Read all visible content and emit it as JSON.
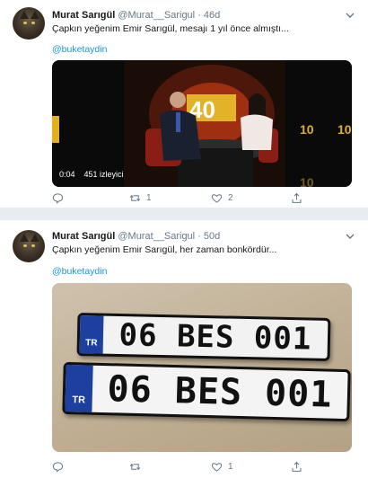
{
  "tweets": [
    {
      "name": "Murat Sarıgül",
      "handle": "@Murat__Sarigul",
      "sep": "·",
      "age": "46d",
      "text": "Çapkın yeğenim Emir Sarıgül, mesajı 1 yıl önce almıştı...",
      "mention": "@buketaydin",
      "video": {
        "time": "0:04",
        "views": "451 izleyici",
        "set_text": "40"
      },
      "actions": {
        "reply": "",
        "retweet": "1",
        "like": "2",
        "share": ""
      }
    },
    {
      "name": "Murat Sarıgül",
      "handle": "@Murat__Sarigul",
      "sep": "·",
      "age": "50d",
      "text": "Çapkın yeğenim Emir Sarıgül, her zaman bonkördür...",
      "mention": "@buketaydin",
      "plates": [
        {
          "country": "TR",
          "number": "06 BES 001"
        },
        {
          "country": "TR",
          "number": "06 BES 001"
        }
      ],
      "actions": {
        "reply": "",
        "retweet": "",
        "like": "1",
        "share": ""
      }
    }
  ],
  "colors": {
    "link": "#1b95e0",
    "muted": "#657786",
    "plate_blue": "#1c3fa0"
  }
}
